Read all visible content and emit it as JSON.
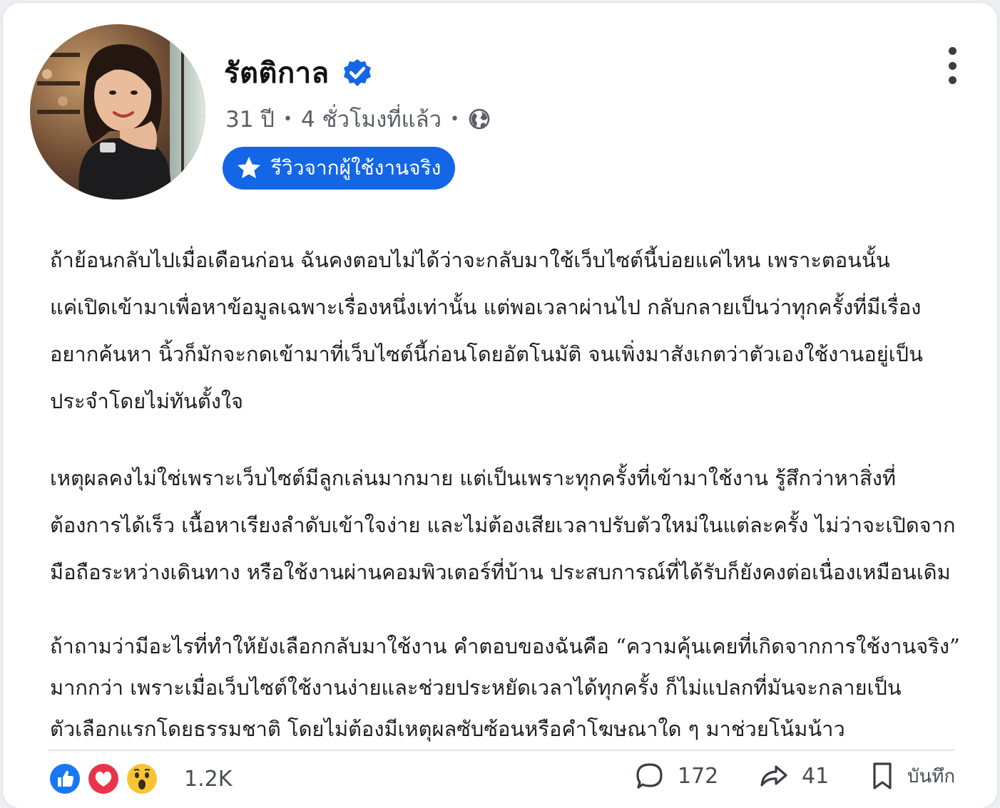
{
  "post": {
    "author": {
      "name": "รัตติกาล",
      "verified": true,
      "avatar": "woman-portrait"
    },
    "meta": {
      "age": "31 ปี",
      "separator": "•",
      "time": "4 ชั่วโมงที่แล้ว",
      "privacy_icon": "globe-icon"
    },
    "badge": {
      "icon": "star-icon",
      "label": "รีวิวจากผู้ใช้งานจริง"
    },
    "body": {
      "paragraphs": [
        {
          "lines": [
            "ถ้าย้อนกลับไปเมื่อเดือนก่อน ฉันคงตอบไม่ได้ว่าจะกลับมาใช้เว็บไซต์นี้บ่อยแค่ไหน เพราะตอนนั้น",
            "แค่เปิดเข้ามาเพื่อหาข้อมูลเฉพาะเรื่องหนึ่งเท่านั้น แต่พอเวลาผ่านไป กลับกลายเป็นว่าทุกครั้งที่มีเรื่อง",
            "อยากค้นหา นิ้วก็มักจะกดเข้ามาที่เว็บไซต์นี้ก่อนโดยอัตโนมัติ จนเพิ่งมาสังเกตว่าตัวเองใช้งานอยู่เป็น",
            "ประจำโดยไม่ทันตั้งใจ"
          ]
        },
        {
          "lines": [
            "เหตุผลคงไม่ใช่เพราะเว็บไซต์มีลูกเล่นมากมาย แต่เป็นเพราะทุกครั้งที่เข้ามาใช้งาน รู้สึกว่าหาสิ่งที่",
            "ต้องการได้เร็ว เนื้อหาเรียงลำดับเข้าใจง่าย และไม่ต้องเสียเวลาปรับตัวใหม่ในแต่ละครั้ง ไม่ว่าจะเปิดจาก",
            "มือถือระหว่างเดินทาง หรือใช้งานผ่านคอมพิวเตอร์ที่บ้าน ประสบการณ์ที่ได้รับก็ยังคงต่อเนื่องเหมือนเดิม"
          ]
        },
        {
          "lines": [
            "ถ้าถามว่ามีอะไรที่ทำให้ยังเลือกกลับมาใช้งาน คำตอบของฉันคือ “ความคุ้นเคยที่เกิดจากการใช้งานจริง”",
            "มากกว่า เพราะเมื่อเว็บไซต์ใช้งานง่ายและช่วยประหยัดเวลาได้ทุกครั้ง ก็ไม่แปลกที่มันจะกลายเป็น",
            "ตัวเลือกแรกโดยธรรมชาติ โดยไม่ต้องมีเหตุผลซับซ้อนหรือคำโฆษณาใด ๆ มาช่วยโน้มน้าว"
          ]
        }
      ]
    },
    "footer": {
      "reactions": [
        "like-icon",
        "love-icon",
        "wow-icon"
      ],
      "reaction_count": "1.2K",
      "comments_count": "172",
      "shares_count": "41",
      "save_label": "บันทึก"
    },
    "colors": {
      "accent": "#1366e6",
      "love": "#e8344a",
      "wow": "#f7c531"
    }
  }
}
